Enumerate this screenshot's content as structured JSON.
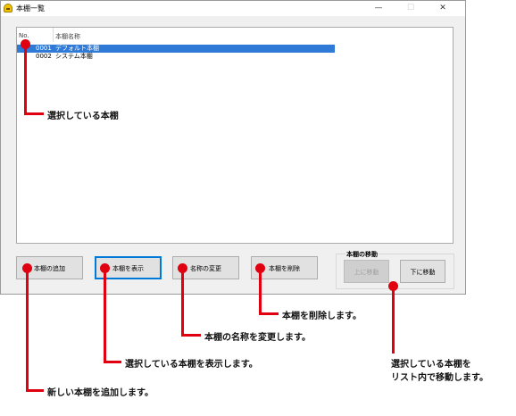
{
  "window": {
    "title": "本棚一覧",
    "min": "—",
    "max": "☐",
    "close": "✕"
  },
  "list": {
    "columns": [
      "No.",
      "本棚名称"
    ],
    "rows": [
      {
        "no": "0001",
        "name": "デフォルト本棚",
        "selected": true
      },
      {
        "no": "0002",
        "name": "システム本棚",
        "selected": false
      }
    ]
  },
  "buttons": {
    "add": "本棚の追加",
    "show": "本棚を表示",
    "rename": "名称の変更",
    "delete": "本棚を削除",
    "move_group": "本棚の移動",
    "move_up": "上に移動",
    "move_down": "下に移動"
  },
  "annotations": {
    "selected": "選択している本棚",
    "delete": "本棚を削除します。",
    "rename": "本棚の名称を変更します。",
    "show": "選択している本棚を表示します。",
    "add": "新しい本棚を追加します。",
    "move_line1": "選択している本棚を",
    "move_line2": "リスト内で移動します。"
  },
  "colors": {
    "marker": "#e0000f",
    "selection": "#2f7ad6",
    "focus_border": "#0078d7"
  }
}
